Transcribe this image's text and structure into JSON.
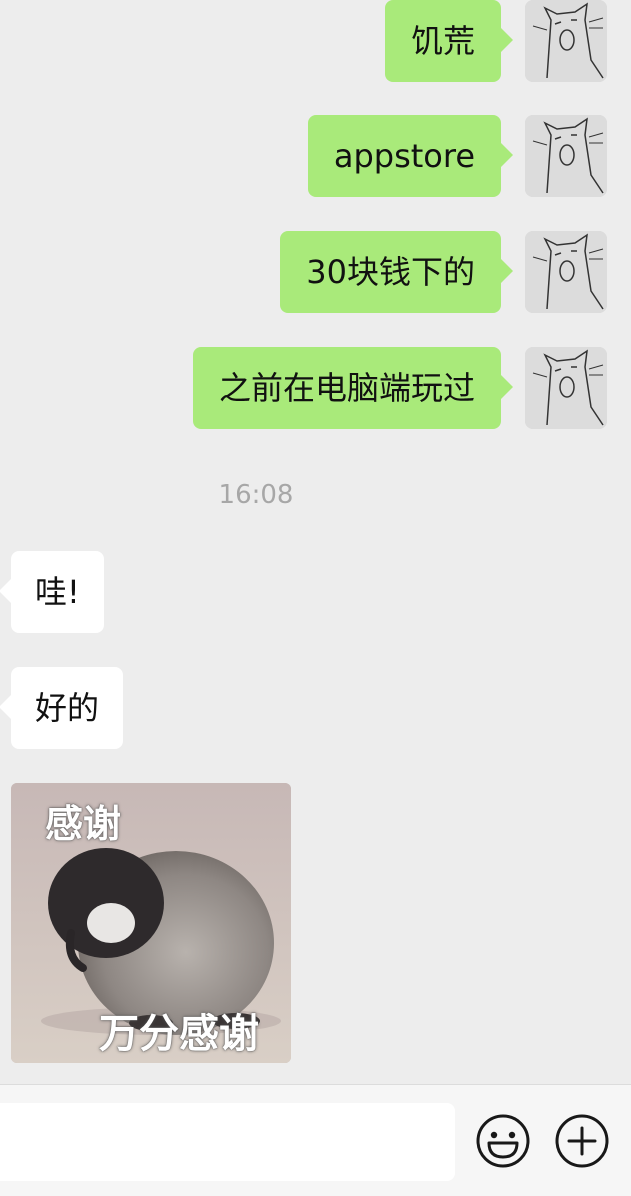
{
  "messages_out": [
    {
      "text": "饥荒"
    },
    {
      "text": "appstore"
    },
    {
      "text": "30块钱下的"
    },
    {
      "text": "之前在电脑端玩过"
    }
  ],
  "timestamp": "16:08",
  "messages_in": [
    {
      "text": "哇!"
    },
    {
      "text": "好的"
    }
  ],
  "sticker": {
    "text_top": "感谢",
    "text_bottom": "万分感谢"
  },
  "toolbar": {
    "emoji_icon": "smile-face-icon",
    "plus_icon": "plus-circle-icon"
  },
  "colors": {
    "background": "#ededed",
    "outgoing_bubble": "#a9ea7a",
    "incoming_bubble": "#ffffff",
    "timestamp": "#a7a7a7"
  }
}
